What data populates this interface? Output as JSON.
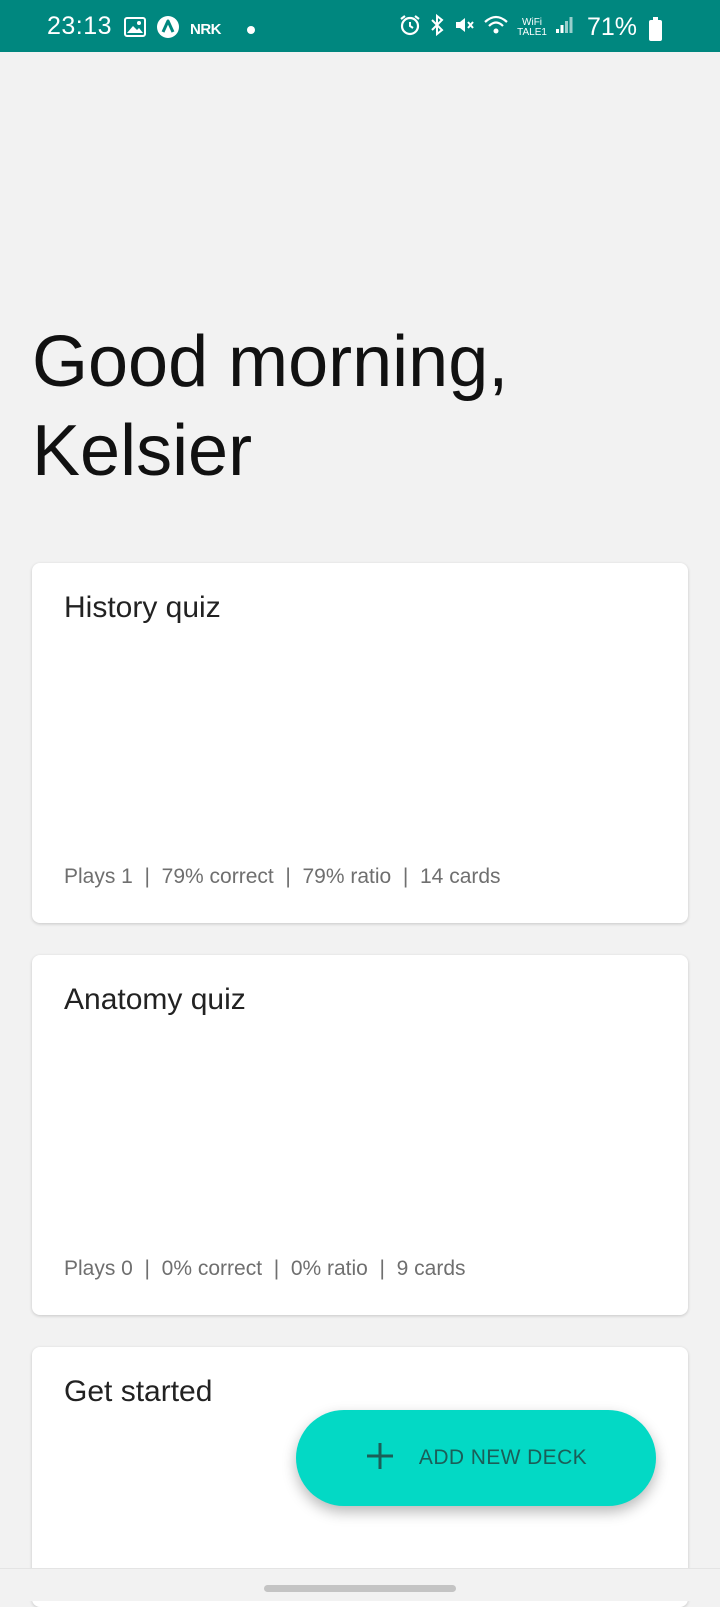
{
  "status_bar": {
    "time": "23:13",
    "left_icons": [
      "image-icon",
      "nav-arrow-icon",
      "nrk-icon",
      "notification-dot-icon"
    ],
    "nrk_label": "NRK",
    "right_icons": [
      "alarm-icon",
      "bluetooth-icon",
      "mute-icon",
      "wifi-icon",
      "signal-icon",
      "battery-icon"
    ],
    "wifi_label": "WiFi",
    "carrier_label": "TALE1",
    "battery": "71%"
  },
  "greeting": {
    "line1": "Good morning,",
    "line2": "Kelsier"
  },
  "decks": [
    {
      "title": "History quiz",
      "stats": "Plays 1  |  79% correct  |  79% ratio  |  14 cards"
    },
    {
      "title": "Anatomy quiz",
      "stats": "Plays 0  |  0% correct  |  0% ratio  |  9 cards"
    },
    {
      "title": "Get started",
      "stats": ""
    }
  ],
  "fab": {
    "label": "ADD NEW DECK",
    "icon": "plus-icon"
  },
  "colors": {
    "status_bar": "#00877f",
    "background": "#f2f2f2",
    "fab": "#03d9c5",
    "fab_text": "#1b5e58"
  }
}
